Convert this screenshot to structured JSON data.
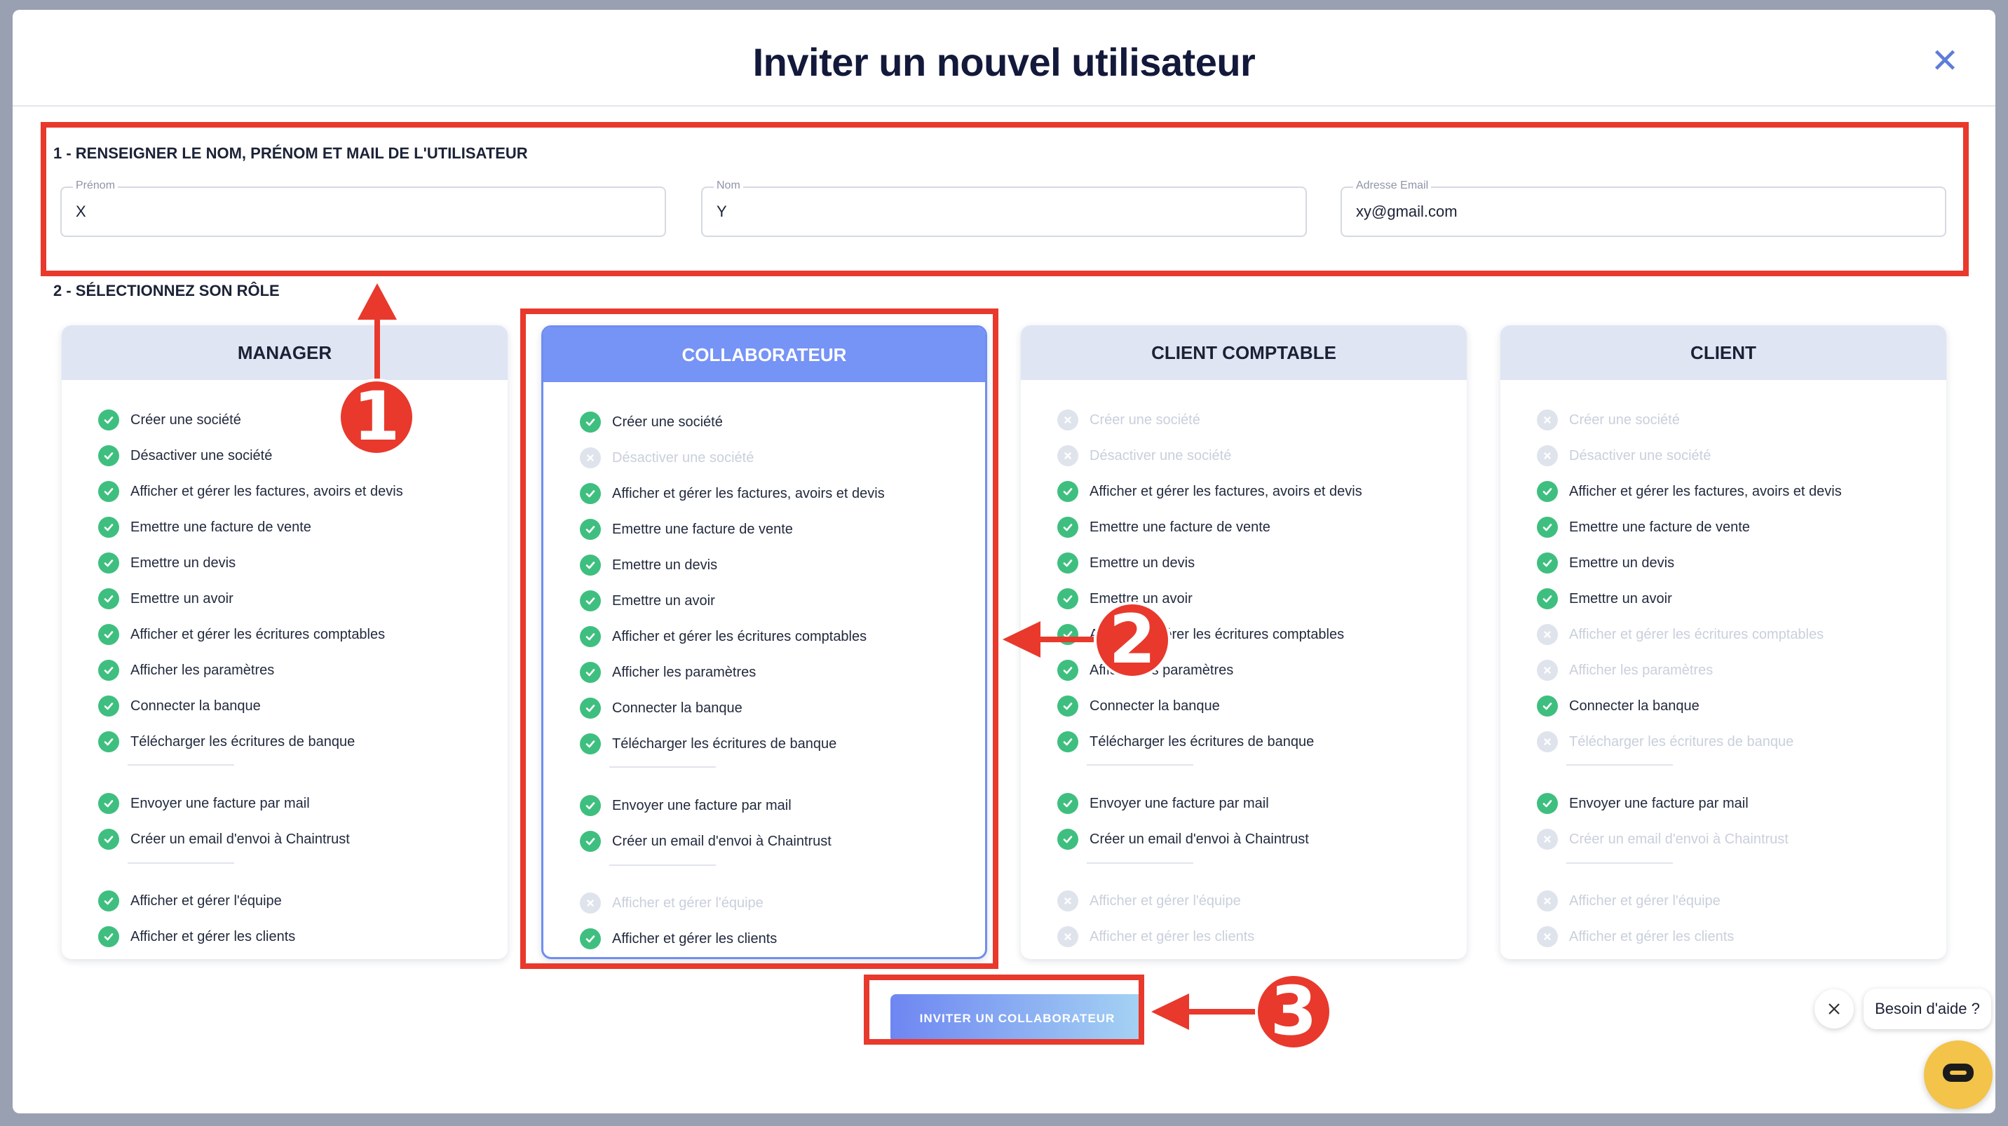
{
  "modal": {
    "title": "Inviter un nouvel utilisateur",
    "close_glyph": "✕"
  },
  "step1": {
    "label": "1 - RENSEIGNER LE NOM, PRÉNOM ET MAIL DE L'UTILISATEUR",
    "fields": [
      {
        "label": "Prénom",
        "value": "X"
      },
      {
        "label": "Nom",
        "value": "Y"
      },
      {
        "label": "Adresse Email",
        "value": "xy@gmail.com"
      }
    ]
  },
  "step2": {
    "label": "2 - SÉLECTIONNEZ SON RÔLE"
  },
  "permission_labels": [
    "Créer une société",
    "Désactiver une société",
    "Afficher et gérer les factures, avoirs et devis",
    "Emettre une facture de vente",
    "Emettre un devis",
    "Emettre un avoir",
    "Afficher et gérer les écritures comptables",
    "Afficher les paramètres",
    "Connecter la banque",
    "Télécharger les écritures de banque",
    "Envoyer une facture par mail",
    "Créer un email d'envoi à Chaintrust",
    "Afficher et gérer l'équipe",
    "Afficher et gérer les clients"
  ],
  "roles": [
    {
      "name": "MANAGER",
      "selected": false,
      "enabled": [
        true,
        true,
        true,
        true,
        true,
        true,
        true,
        true,
        true,
        true,
        true,
        true,
        true,
        true
      ]
    },
    {
      "name": "COLLABORATEUR",
      "selected": true,
      "enabled": [
        true,
        false,
        true,
        true,
        true,
        true,
        true,
        true,
        true,
        true,
        true,
        true,
        false,
        true
      ]
    },
    {
      "name": "CLIENT COMPTABLE",
      "selected": false,
      "enabled": [
        false,
        false,
        true,
        true,
        true,
        true,
        true,
        true,
        true,
        true,
        true,
        true,
        false,
        false
      ]
    },
    {
      "name": "CLIENT",
      "selected": false,
      "enabled": [
        false,
        false,
        true,
        true,
        true,
        true,
        false,
        false,
        true,
        false,
        true,
        false,
        false,
        false
      ]
    }
  ],
  "invite_button": {
    "label": "INVITER UN COLLABORATEUR"
  },
  "annotations": {
    "badges": [
      "1",
      "2",
      "3"
    ],
    "color": "#e8392c"
  },
  "help": {
    "bubble": "Besoin d'aide ?"
  },
  "colors": {
    "accent": "#7693f6",
    "check": "#3fbf7f",
    "chat": "#f3c34a",
    "title": "#13193a"
  }
}
